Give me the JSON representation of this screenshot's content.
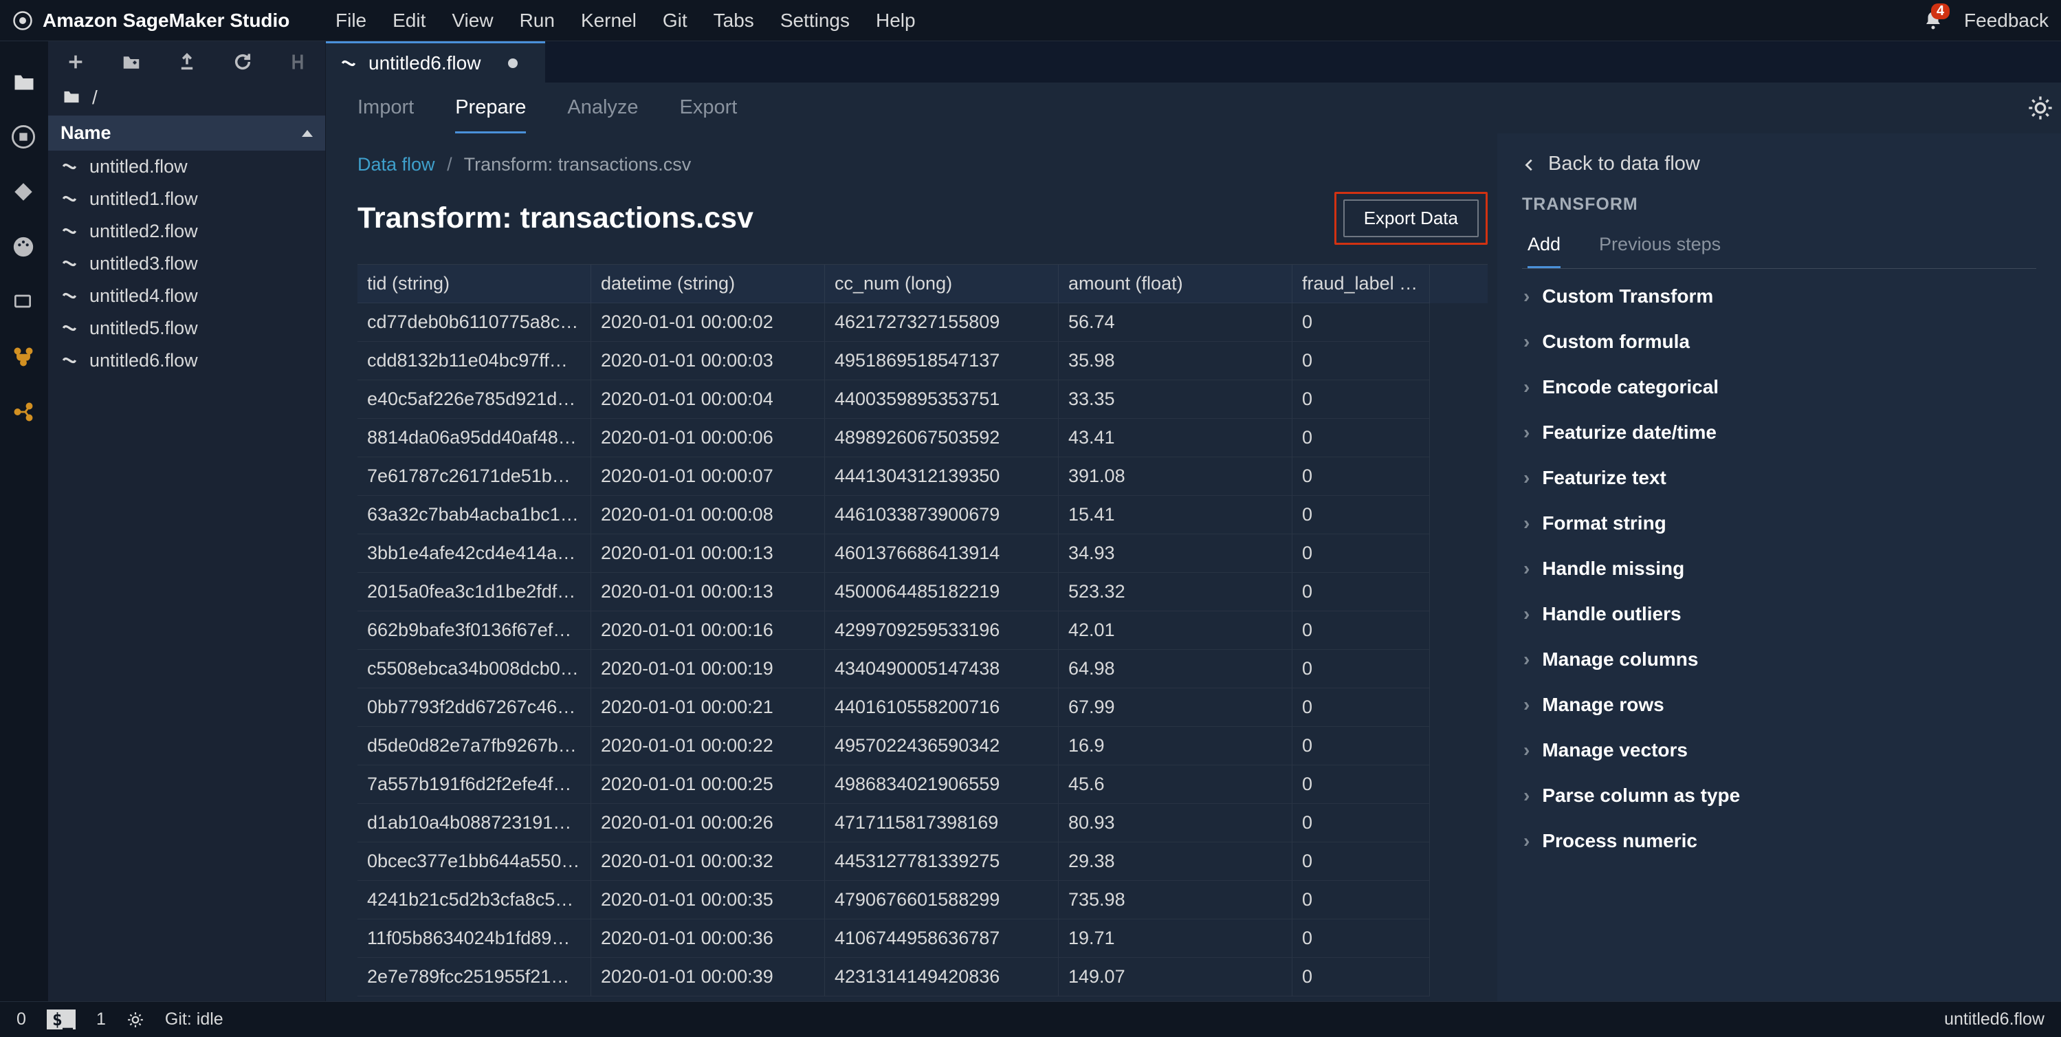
{
  "top": {
    "brand": "Amazon SageMaker Studio",
    "menus": [
      "File",
      "Edit",
      "View",
      "Run",
      "Kernel",
      "Git",
      "Tabs",
      "Settings",
      "Help"
    ],
    "notif_count": "4",
    "feedback": "Feedback"
  },
  "filepanel": {
    "path_sep": "/",
    "header": "Name",
    "files": [
      "untitled.flow",
      "untitled1.flow",
      "untitled2.flow",
      "untitled3.flow",
      "untitled4.flow",
      "untitled5.flow",
      "untitled6.flow"
    ]
  },
  "tab": {
    "file": "untitled6.flow"
  },
  "nav": {
    "tabs": [
      "Import",
      "Prepare",
      "Analyze",
      "Export"
    ],
    "activeIndex": 1
  },
  "crumbs": {
    "link": "Data flow",
    "current": "Transform: transactions.csv"
  },
  "page": {
    "title": "Transform: transactions.csv",
    "export": "Export Data"
  },
  "grid": {
    "cols": [
      "tid (string)",
      "datetime (string)",
      "cc_num (long)",
      "amount (float)",
      "fraud_label (long)"
    ],
    "rows": [
      [
        "cd77deb0b6110775a8c…",
        "2020-01-01 00:00:02",
        "4621727327155809",
        "56.74",
        "0"
      ],
      [
        "cdd8132b11e04bc97ff…",
        "2020-01-01 00:00:03",
        "4951869518547137",
        "35.98",
        "0"
      ],
      [
        "e40c5af226e785d921d…",
        "2020-01-01 00:00:04",
        "4400359895353751",
        "33.35",
        "0"
      ],
      [
        "8814da06a95dd40af48…",
        "2020-01-01 00:00:06",
        "4898926067503592",
        "43.41",
        "0"
      ],
      [
        "7e61787c26171de51b…",
        "2020-01-01 00:00:07",
        "4441304312139350",
        "391.08",
        "0"
      ],
      [
        "63a32c7bab4acba1bc1…",
        "2020-01-01 00:00:08",
        "4461033873900679",
        "15.41",
        "0"
      ],
      [
        "3bb1e4afe42cd4e414a…",
        "2020-01-01 00:00:13",
        "4601376686413914",
        "34.93",
        "0"
      ],
      [
        "2015a0fea3c1d1be2fdf…",
        "2020-01-01 00:00:13",
        "4500064485182219",
        "523.32",
        "0"
      ],
      [
        "662b9bafe3f0136f67ef…",
        "2020-01-01 00:00:16",
        "4299709259533196",
        "42.01",
        "0"
      ],
      [
        "c5508ebca34b008dcb0…",
        "2020-01-01 00:00:19",
        "4340490005147438",
        "64.98",
        "0"
      ],
      [
        "0bb7793f2dd67267c46…",
        "2020-01-01 00:00:21",
        "4401610558200716",
        "67.99",
        "0"
      ],
      [
        "d5de0d82e7a7fb9267b…",
        "2020-01-01 00:00:22",
        "4957022436590342",
        "16.9",
        "0"
      ],
      [
        "7a557b191f6d2f2efe4f…",
        "2020-01-01 00:00:25",
        "4986834021906559",
        "45.6",
        "0"
      ],
      [
        "d1ab10a4b088723191…",
        "2020-01-01 00:00:26",
        "4717115817398169",
        "80.93",
        "0"
      ],
      [
        "0bcec377e1bb644a550…",
        "2020-01-01 00:00:32",
        "4453127781339275",
        "29.38",
        "0"
      ],
      [
        "4241b21c5d2b3cfa8c5…",
        "2020-01-01 00:00:35",
        "4790676601588299",
        "735.98",
        "0"
      ],
      [
        "11f05b8634024b1fd89…",
        "2020-01-01 00:00:36",
        "4106744958636787",
        "19.71",
        "0"
      ],
      [
        "2e7e789fcc251955f21…",
        "2020-01-01 00:00:39",
        "4231314149420836",
        "149.07",
        "0"
      ]
    ]
  },
  "right": {
    "back": "Back to data flow",
    "section": "TRANSFORM",
    "subtabs": [
      "Add",
      "Previous steps"
    ],
    "items": [
      "Custom Transform",
      "Custom formula",
      "Encode categorical",
      "Featurize date/time",
      "Featurize text",
      "Format string",
      "Handle missing",
      "Handle outliers",
      "Manage columns",
      "Manage rows",
      "Manage vectors",
      "Parse column as type",
      "Process numeric"
    ]
  },
  "status": {
    "left_num0": "0",
    "term": "$_",
    "left_num1": "1",
    "git": "Git: idle",
    "right_file": "untitled6.flow"
  }
}
